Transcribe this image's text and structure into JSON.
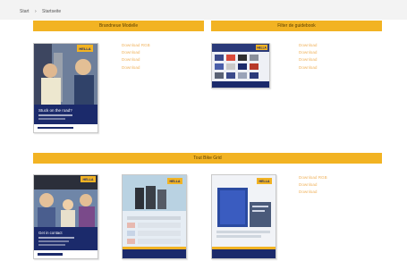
{
  "breadcrumb": {
    "home": "Start",
    "current": "Startseite"
  },
  "sections": [
    {
      "title": "Brandneue Modelle"
    },
    {
      "title": "Filter de guidebook"
    },
    {
      "title": "Tout Bike Grid"
    }
  ],
  "downloads": {
    "group1": [
      "Download RGB",
      "Download",
      "Download",
      "Download"
    ],
    "group2": [
      "Download",
      "Download",
      "Download",
      "Download"
    ],
    "group3": [
      "Download RGB",
      "Download",
      "Download"
    ]
  },
  "colors": {
    "accent": "#f2b323",
    "link": "#f0b35e",
    "brand_blue": "#1b2a6b"
  },
  "thumbnails": {
    "thumb1": {
      "badge": "HELLA",
      "caption": "Stuck on the road?"
    },
    "thumb2": {
      "badge": "HELLA"
    },
    "thumb3": {
      "badge": "HELLA",
      "caption": "Get in contact"
    },
    "thumb4": {
      "badge": "HELLA"
    },
    "thumb5": {
      "badge": "HELLA"
    }
  }
}
